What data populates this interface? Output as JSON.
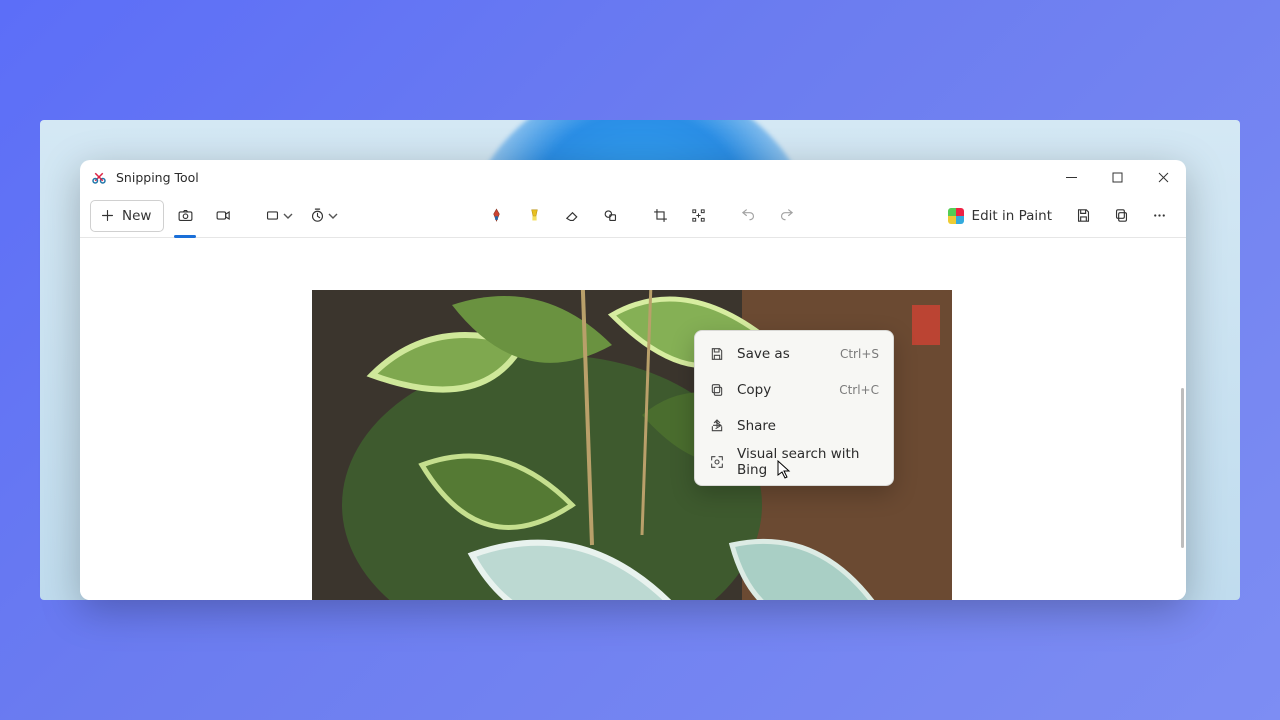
{
  "window": {
    "title": "Snipping Tool",
    "controls": {
      "minimize": "Minimize",
      "maximize": "Maximize",
      "close": "Close"
    }
  },
  "toolbar": {
    "new_label": "New",
    "edit_in_paint_label": "Edit in Paint"
  },
  "context_menu": {
    "items": [
      {
        "label": "Save as",
        "shortcut": "Ctrl+S"
      },
      {
        "label": "Copy",
        "shortcut": "Ctrl+C"
      },
      {
        "label": "Share",
        "shortcut": ""
      },
      {
        "label": "Visual search with Bing",
        "shortcut": ""
      }
    ]
  }
}
